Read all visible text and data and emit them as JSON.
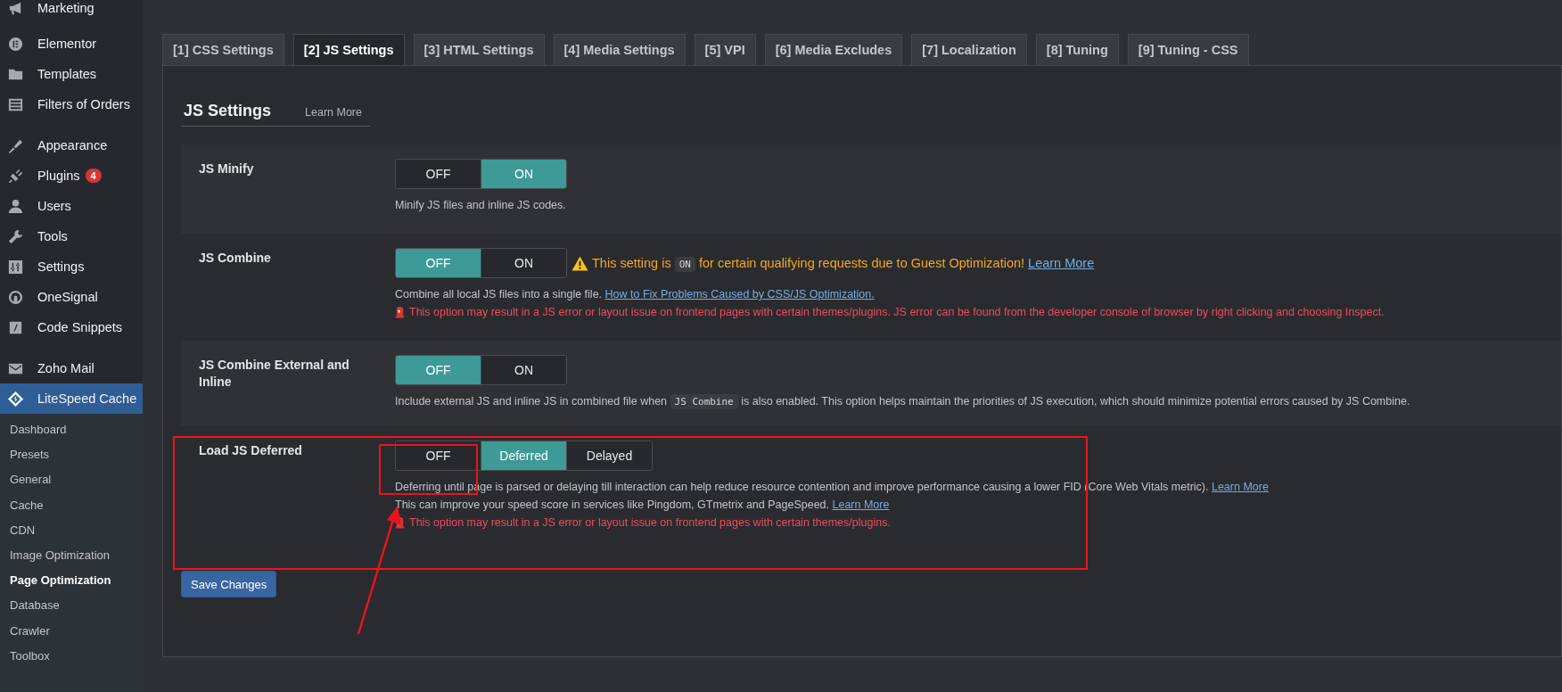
{
  "sidebar": {
    "items": [
      {
        "label": "Marketing",
        "selected": false
      },
      {
        "label": "Elementor",
        "selected": false
      },
      {
        "label": "Templates",
        "selected": false
      },
      {
        "label": "Filters of Orders",
        "selected": false
      },
      {
        "label": "Appearance",
        "selected": false
      },
      {
        "label": "Plugins",
        "badge": "4",
        "selected": false
      },
      {
        "label": "Users",
        "selected": false
      },
      {
        "label": "Tools",
        "selected": false
      },
      {
        "label": "Settings",
        "selected": false
      },
      {
        "label": "OneSignal",
        "selected": false
      },
      {
        "label": "Code Snippets",
        "selected": false
      },
      {
        "label": "Zoho Mail",
        "selected": false
      },
      {
        "label": "LiteSpeed Cache",
        "selected": true
      }
    ],
    "submenu": [
      {
        "label": "Dashboard",
        "selected": false
      },
      {
        "label": "Presets",
        "selected": false
      },
      {
        "label": "General",
        "selected": false
      },
      {
        "label": "Cache",
        "selected": false
      },
      {
        "label": "CDN",
        "selected": false
      },
      {
        "label": "Image Optimization",
        "selected": false
      },
      {
        "label": "Page Optimization",
        "selected": true
      },
      {
        "label": "Database",
        "selected": false
      },
      {
        "label": "Crawler",
        "selected": false
      },
      {
        "label": "Toolbox",
        "selected": false
      }
    ]
  },
  "tabs": [
    {
      "label": "[1] CSS Settings",
      "selected": false
    },
    {
      "label": "[2] JS Settings",
      "selected": true
    },
    {
      "label": "[3] HTML Settings",
      "selected": false
    },
    {
      "label": "[4] Media Settings",
      "selected": false
    },
    {
      "label": "[5] VPI",
      "selected": false
    },
    {
      "label": "[6] Media Excludes",
      "selected": false
    },
    {
      "label": "[7] Localization",
      "selected": false
    },
    {
      "label": "[8] Tuning",
      "selected": false
    },
    {
      "label": "[9] Tuning - CSS",
      "selected": false
    }
  ],
  "section": {
    "title": "JS Settings",
    "learn_more": "Learn More"
  },
  "settings": [
    {
      "label": "JS Minify",
      "options": [
        {
          "label": "OFF",
          "selected": false
        },
        {
          "label": "ON",
          "selected": true
        }
      ],
      "lines": [
        {
          "kind": "note",
          "parts": [
            {
              "kind": "text",
              "text": "Minify JS files and inline JS codes."
            }
          ]
        }
      ]
    },
    {
      "label": "JS Combine",
      "options": [
        {
          "label": "OFF",
          "selected": true
        },
        {
          "label": "ON",
          "selected": false
        }
      ],
      "warning": [
        {
          "kind": "text",
          "text": "This setting is "
        },
        {
          "kind": "code",
          "text": "ON"
        },
        {
          "kind": "text",
          "text": " for certain qualifying requests due to Guest Optimization! "
        },
        {
          "kind": "link",
          "text": "Learn More"
        }
      ],
      "lines": [
        {
          "kind": "note",
          "parts": [
            {
              "kind": "text",
              "text": "Combine all local JS files into a single file. "
            },
            {
              "kind": "link",
              "text": "How to Fix Problems Caused by CSS/JS Optimization."
            }
          ]
        },
        {
          "kind": "danger",
          "parts": [
            {
              "kind": "text",
              "text": "This option may result in a JS error or layout issue on frontend pages with certain themes/plugins. JS error can be found from the developer console of browser by right clicking and choosing Inspect."
            }
          ]
        }
      ]
    },
    {
      "label": "JS Combine External and Inline",
      "options": [
        {
          "label": "OFF",
          "selected": true
        },
        {
          "label": "ON",
          "selected": false
        }
      ],
      "lines": [
        {
          "kind": "note",
          "parts": [
            {
              "kind": "text",
              "text": "Include external JS and inline JS in combined file when "
            },
            {
              "kind": "code",
              "text": "JS Combine"
            },
            {
              "kind": "text",
              "text": " is also enabled. This option helps maintain the priorities of JS execution, which should minimize potential errors caused by JS Combine."
            }
          ]
        }
      ]
    },
    {
      "label": "Load JS Deferred",
      "options": [
        {
          "label": "OFF",
          "selected": false
        },
        {
          "label": "Deferred",
          "selected": true
        },
        {
          "label": "Delayed",
          "selected": false
        }
      ],
      "lines": [
        {
          "kind": "note",
          "parts": [
            {
              "kind": "text",
              "text": "Deferring until page is parsed or delaying till interaction can help reduce resource contention and improve performance causing a lower FID (Core Web Vitals metric). "
            },
            {
              "kind": "link",
              "text": "Learn More"
            }
          ]
        },
        {
          "kind": "note",
          "parts": [
            {
              "kind": "text",
              "text": "This can improve your speed score in services like Pingdom, GTmetrix and PageSpeed. "
            },
            {
              "kind": "link",
              "text": "Learn More"
            }
          ]
        },
        {
          "kind": "danger",
          "parts": [
            {
              "kind": "text",
              "text": "This option may result in a JS error or layout issue on frontend pages with certain themes/plugins."
            }
          ]
        }
      ]
    }
  ],
  "save_button": "Save Changes"
}
